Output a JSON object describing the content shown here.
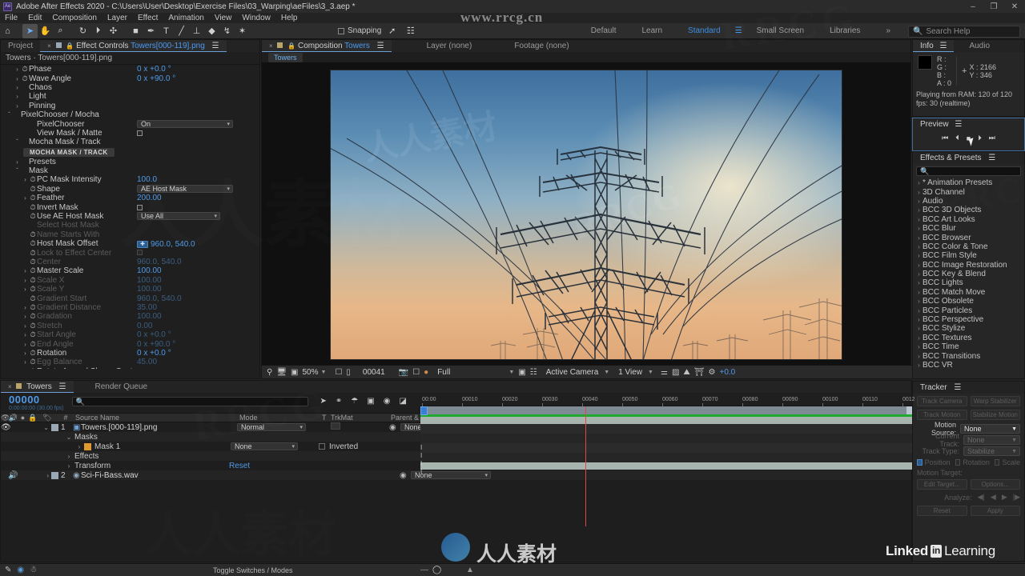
{
  "window": {
    "app_icon": "Ae",
    "title": "Adobe After Effects 2020 - C:\\Users\\User\\Desktop\\Exercise Files\\03_Warping\\aeFiles\\3_3.aep *",
    "minimize": "–",
    "maximize": "❐",
    "close": "✕"
  },
  "menu": [
    "File",
    "Edit",
    "Composition",
    "Layer",
    "Effect",
    "Animation",
    "View",
    "Window",
    "Help"
  ],
  "toolbar": {
    "tools": [
      {
        "name": "home-icon",
        "glyph": "⌂"
      },
      {
        "name": "selection-tool",
        "glyph": "➤"
      },
      {
        "name": "hand-tool",
        "glyph": "✋"
      },
      {
        "name": "zoom-tool",
        "glyph": "⌕"
      },
      {
        "name": "rotation-tool",
        "glyph": "↻"
      },
      {
        "name": "camera-tool",
        "glyph": "⏵"
      },
      {
        "name": "pan-behind-tool",
        "glyph": "✣"
      },
      {
        "name": "shape-tool",
        "glyph": "■"
      },
      {
        "name": "pen-tool",
        "glyph": "✒"
      },
      {
        "name": "type-tool",
        "glyph": "T"
      },
      {
        "name": "brush-tool",
        "glyph": "╱"
      },
      {
        "name": "clone-stamp-tool",
        "glyph": "⊥"
      },
      {
        "name": "eraser-tool",
        "glyph": "◆"
      },
      {
        "name": "roto-brush-tool",
        "glyph": "↯"
      },
      {
        "name": "puppet-pin-tool",
        "glyph": "✶"
      }
    ],
    "snapping_label": "Snapping"
  },
  "workspaces": {
    "tabs": [
      "Default",
      "Learn",
      "Standard",
      "Small Screen",
      "Libraries"
    ],
    "selected": "Standard",
    "overflow": "»",
    "search_placeholder": "Search Help"
  },
  "effect_controls": {
    "tabs": [
      {
        "label": "Project",
        "selected": false
      },
      {
        "label": "Effect Controls ",
        "highlight": "Towers[000-119].png",
        "selected": true
      }
    ],
    "subtitle": "Towers · Towers[000-119].png",
    "rows": [
      {
        "indent": 1,
        "twirl": "›",
        "stop": true,
        "label": "Phase",
        "value": "0 x +0.0 °",
        "type": "number",
        "dim": false
      },
      {
        "indent": 1,
        "twirl": "›",
        "stop": true,
        "label": "Wave Angle",
        "value": "0 x +90.0 °",
        "type": "number",
        "dim": false
      },
      {
        "indent": 1,
        "twirl": "›",
        "stop": false,
        "label": "Chaos",
        "value": "",
        "type": "group",
        "dim": false
      },
      {
        "indent": 1,
        "twirl": "›",
        "stop": false,
        "label": "Light",
        "value": "",
        "type": "group",
        "dim": false
      },
      {
        "indent": 1,
        "twirl": "›",
        "stop": false,
        "label": "Pinning",
        "value": "",
        "type": "group",
        "dim": false
      },
      {
        "indent": 0,
        "twirl": "ˇ",
        "stop": false,
        "label": "PixelChooser / Mocha",
        "value": "",
        "type": "group",
        "dim": false
      },
      {
        "indent": 2,
        "twirl": "",
        "stop": false,
        "label": "PixelChooser",
        "value": "On",
        "type": "dropdown",
        "dim": false
      },
      {
        "indent": 2,
        "twirl": "",
        "stop": false,
        "label": "View Mask / Matte",
        "value": "",
        "type": "checkbox",
        "dim": false
      },
      {
        "indent": 1,
        "twirl": "ˇ",
        "stop": false,
        "label": "Mocha Mask / Track",
        "value": "",
        "type": "group",
        "dim": false
      },
      {
        "indent": 0,
        "twirl": "",
        "stop": false,
        "label": "MOCHA MASK / TRACK",
        "value": "",
        "type": "badge",
        "dim": false
      },
      {
        "indent": 1,
        "twirl": "›",
        "stop": false,
        "label": "Presets",
        "value": "",
        "type": "group",
        "dim": false
      },
      {
        "indent": 1,
        "twirl": "ˇ",
        "stop": false,
        "label": "Mask",
        "value": "",
        "type": "group",
        "dim": false
      },
      {
        "indent": 2,
        "twirl": "›",
        "stop": true,
        "label": "PC Mask Intensity",
        "value": "100.0",
        "type": "number",
        "dim": false
      },
      {
        "indent": 2,
        "twirl": "",
        "stop": true,
        "label": "Shape",
        "value": "AE Host Mask",
        "type": "dropdown",
        "dim": false
      },
      {
        "indent": 2,
        "twirl": "›",
        "stop": true,
        "label": "Feather",
        "value": "200.00",
        "type": "number",
        "dim": false
      },
      {
        "indent": 2,
        "twirl": "",
        "stop": true,
        "label": "Invert Mask",
        "value": "",
        "type": "checkbox",
        "dim": false
      },
      {
        "indent": 2,
        "twirl": "",
        "stop": true,
        "label": "Use AE Host Mask",
        "value": "Use All",
        "type": "dropdown2",
        "dim": false
      },
      {
        "indent": 2,
        "twirl": "",
        "stop": false,
        "label": "Select Host Mask",
        "value": "",
        "type": "group",
        "dim": true
      },
      {
        "indent": 2,
        "twirl": "",
        "stop": true,
        "label": "Name Starts With",
        "value": "",
        "type": "text",
        "dim": true
      },
      {
        "indent": 2,
        "twirl": "",
        "stop": true,
        "label": "Host Mask Offset",
        "value": "960.0, 540.0",
        "type": "offset",
        "dim": false
      },
      {
        "indent": 2,
        "twirl": "",
        "stop": true,
        "label": "Lock to Effect Center",
        "value": "",
        "type": "checkbox",
        "dim": true
      },
      {
        "indent": 2,
        "twirl": "",
        "stop": true,
        "label": "Center",
        "value": "960.0, 540.0",
        "type": "number",
        "dim": true
      },
      {
        "indent": 2,
        "twirl": "›",
        "stop": true,
        "label": "Master Scale",
        "value": "100.00",
        "type": "number",
        "dim": false
      },
      {
        "indent": 2,
        "twirl": "›",
        "stop": true,
        "label": "Scale X",
        "value": "100.00",
        "type": "number",
        "dim": true
      },
      {
        "indent": 2,
        "twirl": "›",
        "stop": true,
        "label": "Scale Y",
        "value": "100.00",
        "type": "number",
        "dim": true
      },
      {
        "indent": 2,
        "twirl": "",
        "stop": true,
        "label": "Gradient Start",
        "value": "960.0, 540.0",
        "type": "number",
        "dim": true
      },
      {
        "indent": 2,
        "twirl": "›",
        "stop": true,
        "label": "Gradient Distance",
        "value": "35.00",
        "type": "number",
        "dim": true
      },
      {
        "indent": 2,
        "twirl": "›",
        "stop": true,
        "label": "Gradation",
        "value": "100.00",
        "type": "number",
        "dim": true
      },
      {
        "indent": 2,
        "twirl": "›",
        "stop": true,
        "label": "Stretch",
        "value": "0.00",
        "type": "number",
        "dim": true
      },
      {
        "indent": 2,
        "twirl": "›",
        "stop": true,
        "label": "Start Angle",
        "value": "0 x +0.0 °",
        "type": "number",
        "dim": true
      },
      {
        "indent": 2,
        "twirl": "›",
        "stop": true,
        "label": "End Angle",
        "value": "0 x +90.0 °",
        "type": "number",
        "dim": true
      },
      {
        "indent": 2,
        "twirl": "›",
        "stop": true,
        "label": "Rotation",
        "value": "0 x +0.0 °",
        "type": "number",
        "dim": false
      },
      {
        "indent": 2,
        "twirl": "›",
        "stop": true,
        "label": "Egg Balance",
        "value": "45.00",
        "type": "number",
        "dim": true
      },
      {
        "indent": 2,
        "twirl": "",
        "stop": true,
        "label": "Rotate Around Shape Center",
        "value": "",
        "type": "checkbox",
        "dim": false
      }
    ]
  },
  "composition": {
    "tabs": [
      {
        "label": "Composition ",
        "highlight": "Towers",
        "selected": true
      },
      {
        "label": "Layer (none)",
        "selected": false
      },
      {
        "label": "Footage (none)",
        "selected": false
      }
    ],
    "breadcrumb": "Towers",
    "viewer_bar": {
      "zoom": "50%",
      "frame": "00041",
      "resolution": "Full",
      "camera": "Active Camera",
      "views": "1 View",
      "exposure": "+0.0"
    }
  },
  "info": {
    "tabs": [
      "Info",
      "Audio"
    ],
    "selected": "Info",
    "channels": [
      {
        "key": "R :",
        "value": ""
      },
      {
        "key": "G :",
        "value": ""
      },
      {
        "key": "B :",
        "value": ""
      },
      {
        "key": "A :",
        "value": "0"
      }
    ],
    "x_label": "X : 2166",
    "y_label": "Y : 346",
    "ram_line1": "Playing from RAM: 120 of 120",
    "ram_line2": "fps: 30 (realtime)"
  },
  "preview": {
    "title": "Preview",
    "buttons": [
      {
        "name": "go-to-start-button",
        "glyph": "⏮"
      },
      {
        "name": "step-back-button",
        "glyph": "⏴"
      },
      {
        "name": "stop-button",
        "glyph": "■"
      },
      {
        "name": "play-button",
        "glyph": "⏵"
      },
      {
        "name": "go-to-end-button",
        "glyph": "⏭"
      }
    ]
  },
  "effects_presets": {
    "title": "Effects & Presets",
    "search_placeholder": "",
    "items": [
      "* Animation Presets",
      "3D Channel",
      "Audio",
      "BCC 3D Objects",
      "BCC Art Looks",
      "BCC Blur",
      "BCC Browser",
      "BCC Color & Tone",
      "BCC Film Style",
      "BCC Image Restoration",
      "BCC Key & Blend",
      "BCC Lights",
      "BCC Match Move",
      "BCC Obsolete",
      "BCC Particles",
      "BCC Perspective",
      "BCC Stylize",
      "BCC Textures",
      "BCC Time",
      "BCC Transitions",
      "BCC VR"
    ]
  },
  "tracker": {
    "title": "Tracker",
    "buttons": [
      {
        "label": "Track Camera",
        "enabled": false
      },
      {
        "label": "Warp Stabilizer",
        "enabled": false
      },
      {
        "label": "Track Motion",
        "enabled": false
      },
      {
        "label": "Stabilize Motion",
        "enabled": false
      }
    ],
    "motion_source_label": "Motion Source:",
    "motion_source_value": "None",
    "current_track_label": "Current Track:",
    "current_track_value": "None",
    "track_type_label": "Track Type:",
    "track_type_value": "Stabilize",
    "checks": [
      {
        "label": "Position",
        "checked": true
      },
      {
        "label": "Rotation",
        "checked": false
      },
      {
        "label": "Scale",
        "checked": false
      }
    ],
    "motion_target_label": "Motion Target:",
    "edit_target_label": "Edit Target...",
    "options_label": "Options...",
    "analyze_label": "Analyze:",
    "reset_label": "Reset",
    "apply_label": "Apply"
  },
  "timeline": {
    "tabs": [
      {
        "label": "Towers",
        "selected": true
      },
      {
        "label": "Render Queue",
        "selected": false
      }
    ],
    "current_time": "00000",
    "time_sub": "0:00:00:00 (30.00 fps)",
    "search_placeholder": "",
    "columns": [
      "Source Name",
      "Mode",
      "T",
      "TrkMat",
      "Parent & Link"
    ],
    "layers": [
      {
        "index": "1",
        "name": "Towers.[000-119].png",
        "mode": "Normal",
        "parent": "None",
        "type": "image"
      },
      {
        "index": "",
        "name": "Masks",
        "mode": "",
        "parent": "",
        "type": "group"
      },
      {
        "index": "",
        "name": "Mask 1",
        "mode": "None",
        "inverted": "Inverted",
        "parent": "",
        "type": "mask"
      },
      {
        "index": "",
        "name": "Effects",
        "mode": "",
        "parent": "",
        "type": "group"
      },
      {
        "index": "",
        "name": "Transform",
        "mode": "Reset",
        "parent": "",
        "type": "group"
      },
      {
        "index": "2",
        "name": "Sci-Fi-Bass.wav",
        "mode": "",
        "parent": "None",
        "type": "audio"
      }
    ],
    "ruler_ticks": [
      "00:00",
      "00010",
      "00020",
      "00030",
      "00040",
      "00050",
      "00060",
      "00070",
      "00080",
      "00090",
      "00100",
      "00110",
      "0012"
    ],
    "toggle_label": "Toggle Switches / Modes"
  },
  "watermarks": {
    "top": "www.rrcg.cn",
    "brand": "RRCG",
    "cn_text": "人人素材",
    "linkedin": "Linked",
    "linkedin_in": "in",
    "linkedin_learning": "Learning"
  },
  "colors": {
    "accent_blue": "#4f9ae8",
    "panel_bg": "#262626",
    "app_bg": "#232323",
    "green_bar": "#1fa92f",
    "playhead_red": "#d94b4b"
  }
}
